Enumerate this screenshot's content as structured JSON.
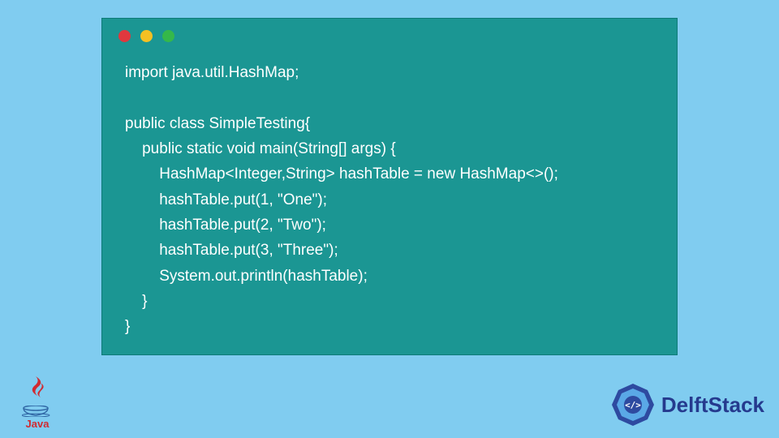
{
  "code": {
    "lines": [
      "import java.util.HashMap;",
      "",
      "public class SimpleTesting{",
      "    public static void main(String[] args) {",
      "        HashMap<Integer,String> hashTable = new HashMap<>();",
      "        hashTable.put(1, \"One\");",
      "        hashTable.put(2, \"Two\");",
      "        hashTable.put(3, \"Three\");",
      "        System.out.println(hashTable);",
      "    }",
      "}"
    ],
    "text": "import java.util.HashMap;\n\npublic class SimpleTesting{\n    public static void main(String[] args) {\n        HashMap<Integer,String> hashTable = new HashMap<>();\n        hashTable.put(1, \"One\");\n        hashTable.put(2, \"Two\");\n        hashTable.put(3, \"Three\");\n        System.out.println(hashTable);\n    }\n}"
  },
  "logos": {
    "java_label": "Java",
    "delft_label": "DelftStack"
  },
  "colors": {
    "background": "#80ccf0",
    "code_bg": "#1b9693",
    "code_text": "#ffffff",
    "java_red": "#d12a30",
    "delft_blue": "#253a8e"
  }
}
